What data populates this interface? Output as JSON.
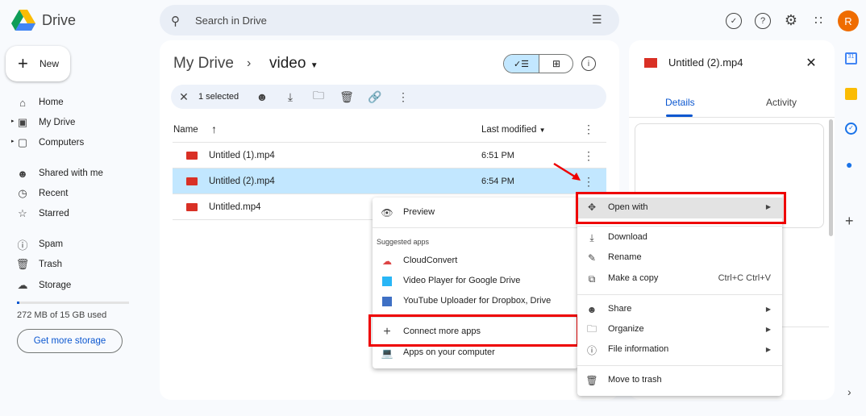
{
  "app": {
    "title": "Drive",
    "avatar": "R"
  },
  "search": {
    "placeholder": "Search in Drive"
  },
  "new_label": "New",
  "sidebar": {
    "items": [
      {
        "label": "Home",
        "icon": "home-icon"
      },
      {
        "label": "My Drive",
        "icon": "my-drive-icon"
      },
      {
        "label": "Computers",
        "icon": "computers-icon"
      },
      {
        "label": "Shared with me",
        "icon": "shared-icon"
      },
      {
        "label": "Recent",
        "icon": "clock-icon"
      },
      {
        "label": "Starred",
        "icon": "star-icon"
      },
      {
        "label": "Spam",
        "icon": "spam-icon"
      },
      {
        "label": "Trash",
        "icon": "trash-icon"
      },
      {
        "label": "Storage",
        "icon": "cloud-icon"
      }
    ],
    "storage_text": "272 MB of 15 GB used",
    "storage_fraction": 0.018,
    "get_storage": "Get more storage"
  },
  "breadcrumb": {
    "root": "My Drive",
    "current": "video"
  },
  "toolbar": {
    "selected": "1 selected"
  },
  "table": {
    "headers": {
      "name": "Name",
      "modified": "Last modified"
    },
    "rows": [
      {
        "name": "Untitled (1).mp4",
        "time": "6:51 PM"
      },
      {
        "name": "Untitled (2).mp4",
        "time": "6:54 PM",
        "selected": true
      },
      {
        "name": "Untitled.mp4",
        "time": ""
      }
    ]
  },
  "submenu": {
    "preview": "Preview",
    "section": "Suggested apps",
    "apps": [
      "CloudConvert",
      "Video Player for Google Drive",
      "YouTube Uploader for Dropbox, Drive"
    ],
    "connect": "Connect more apps",
    "computer": "Apps on your computer"
  },
  "context_menu": {
    "open_with": "Open with",
    "download": "Download",
    "rename": "Rename",
    "copy": "Make a copy",
    "copy_shortcut": "Ctrl+C Ctrl+V",
    "share": "Share",
    "organize": "Organize",
    "info": "File information",
    "trash": "Move to trash"
  },
  "details": {
    "title": "Untitled (2).mp4",
    "tabs": [
      "Details",
      "Activity"
    ]
  },
  "colors": {
    "accent": "#0b57d0",
    "highlight": "#e00000",
    "selected_row": "#c2e7ff",
    "avatar": "#ef6c00"
  }
}
